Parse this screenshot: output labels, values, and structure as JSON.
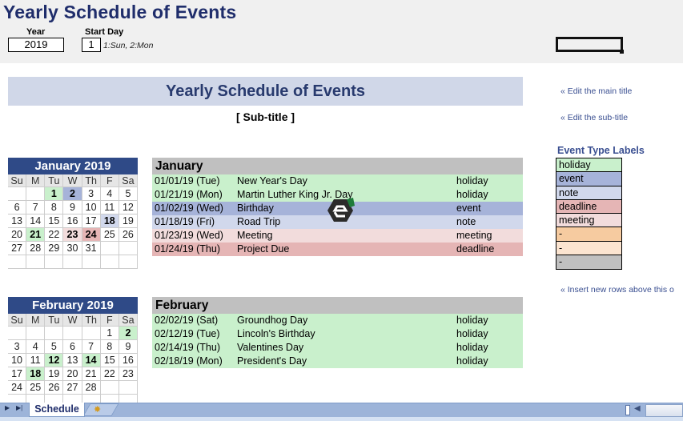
{
  "header": {
    "app_title": "Yearly Schedule of Events",
    "year_label": "Year",
    "year_value": "2019",
    "start_day_label": "Start Day",
    "start_day_value": "1",
    "start_day_hint": "1:Sun, 2:Mon"
  },
  "main": {
    "title": "Yearly Schedule of Events",
    "subtitle": "[ Sub-title ]"
  },
  "links": {
    "edit_main_title": "« Edit the main title",
    "edit_sub_title": "« Edit the sub-title",
    "insert_rows": "« Insert new rows above this o"
  },
  "legend": {
    "title": "Event Type Labels",
    "items": [
      {
        "label": "holiday",
        "color": "#c9f0cc"
      },
      {
        "label": "event",
        "color": "#a6b3d9"
      },
      {
        "label": "note",
        "color": "#d1d8ec"
      },
      {
        "label": "deadline",
        "color": "#e5b5b5"
      },
      {
        "label": "meeting",
        "color": "#f2dcdc"
      },
      {
        "label": " -",
        "color": "#f6cba0"
      },
      {
        "label": " -",
        "color": "#fbe4d0"
      },
      {
        "label": " -",
        "color": "#c0c0c0"
      }
    ]
  },
  "calendars": [
    {
      "title": "January 2019",
      "dow": [
        "Su",
        "M",
        "Tu",
        "W",
        "Th",
        "F",
        "Sa"
      ],
      "days": [
        {
          "d": ""
        },
        {
          "d": ""
        },
        {
          "d": "1",
          "type": "holiday"
        },
        {
          "d": "2",
          "type": "event"
        },
        {
          "d": "3"
        },
        {
          "d": "4"
        },
        {
          "d": "5"
        },
        {
          "d": "6"
        },
        {
          "d": "7"
        },
        {
          "d": "8"
        },
        {
          "d": "9"
        },
        {
          "d": "10"
        },
        {
          "d": "11"
        },
        {
          "d": "12"
        },
        {
          "d": "13"
        },
        {
          "d": "14"
        },
        {
          "d": "15"
        },
        {
          "d": "16"
        },
        {
          "d": "17"
        },
        {
          "d": "18",
          "type": "note"
        },
        {
          "d": "19"
        },
        {
          "d": "20"
        },
        {
          "d": "21",
          "type": "holiday"
        },
        {
          "d": "22"
        },
        {
          "d": "23",
          "type": "meeting"
        },
        {
          "d": "24",
          "type": "deadline"
        },
        {
          "d": "25"
        },
        {
          "d": "26"
        },
        {
          "d": "27"
        },
        {
          "d": "28"
        },
        {
          "d": "29"
        },
        {
          "d": "30"
        },
        {
          "d": "31"
        },
        {
          "d": ""
        },
        {
          "d": ""
        },
        {
          "d": ""
        },
        {
          "d": ""
        },
        {
          "d": ""
        },
        {
          "d": ""
        },
        {
          "d": ""
        },
        {
          "d": ""
        },
        {
          "d": ""
        }
      ]
    },
    {
      "title": "February 2019",
      "dow": [
        "Su",
        "M",
        "Tu",
        "W",
        "Th",
        "F",
        "Sa"
      ],
      "days": [
        {
          "d": ""
        },
        {
          "d": ""
        },
        {
          "d": ""
        },
        {
          "d": ""
        },
        {
          "d": ""
        },
        {
          "d": "1"
        },
        {
          "d": "2",
          "type": "holiday"
        },
        {
          "d": "3"
        },
        {
          "d": "4"
        },
        {
          "d": "5"
        },
        {
          "d": "6"
        },
        {
          "d": "7"
        },
        {
          "d": "8"
        },
        {
          "d": "9"
        },
        {
          "d": "10"
        },
        {
          "d": "11"
        },
        {
          "d": "12",
          "type": "holiday"
        },
        {
          "d": "13"
        },
        {
          "d": "14",
          "type": "holiday"
        },
        {
          "d": "15"
        },
        {
          "d": "16"
        },
        {
          "d": "17"
        },
        {
          "d": "18",
          "type": "holiday"
        },
        {
          "d": "19"
        },
        {
          "d": "20"
        },
        {
          "d": "21"
        },
        {
          "d": "22"
        },
        {
          "d": "23"
        },
        {
          "d": "24"
        },
        {
          "d": "25"
        },
        {
          "d": "26"
        },
        {
          "d": "27"
        },
        {
          "d": "28"
        },
        {
          "d": ""
        },
        {
          "d": ""
        },
        {
          "d": ""
        },
        {
          "d": ""
        },
        {
          "d": ""
        },
        {
          "d": ""
        },
        {
          "d": ""
        },
        {
          "d": ""
        },
        {
          "d": ""
        }
      ]
    }
  ],
  "events": [
    {
      "month": "January",
      "rows": [
        {
          "date": "01/01/19 (Tue)",
          "name": "New Year's Day",
          "type": "holiday"
        },
        {
          "date": "01/21/19 (Mon)",
          "name": "Martin Luther King Jr. Day",
          "type": "holiday"
        },
        {
          "date": "01/02/19 (Wed)",
          "name": "Birthday",
          "type": "event"
        },
        {
          "date": "01/18/19 (Fri)",
          "name": "Road Trip",
          "type": "note"
        },
        {
          "date": "01/23/19 (Wed)",
          "name": "Meeting",
          "type": "meeting"
        },
        {
          "date": "01/24/19 (Thu)",
          "name": "Project Due",
          "type": "deadline"
        }
      ]
    },
    {
      "month": "February",
      "rows": [
        {
          "date": "02/02/19 (Sat)",
          "name": "Groundhog Day",
          "type": "holiday"
        },
        {
          "date": "02/12/19 (Tue)",
          "name": "Lincoln's Birthday",
          "type": "holiday"
        },
        {
          "date": "02/14/19 (Thu)",
          "name": "Valentines Day",
          "type": "holiday"
        },
        {
          "date": "02/18/19 (Mon)",
          "name": "President's Day",
          "type": "holiday"
        }
      ]
    }
  ],
  "type_colors": {
    "holiday": "#c9f0cc",
    "event": "#a6b3d9",
    "note": "#d1d8ec",
    "deadline": "#e5b5b5",
    "meeting": "#f2dcdc"
  },
  "sheet_tabs": {
    "active": "Schedule",
    "nav_next": "▶",
    "nav_last": "▶|",
    "new_sheet_icon": "insert-sheet-icon"
  }
}
